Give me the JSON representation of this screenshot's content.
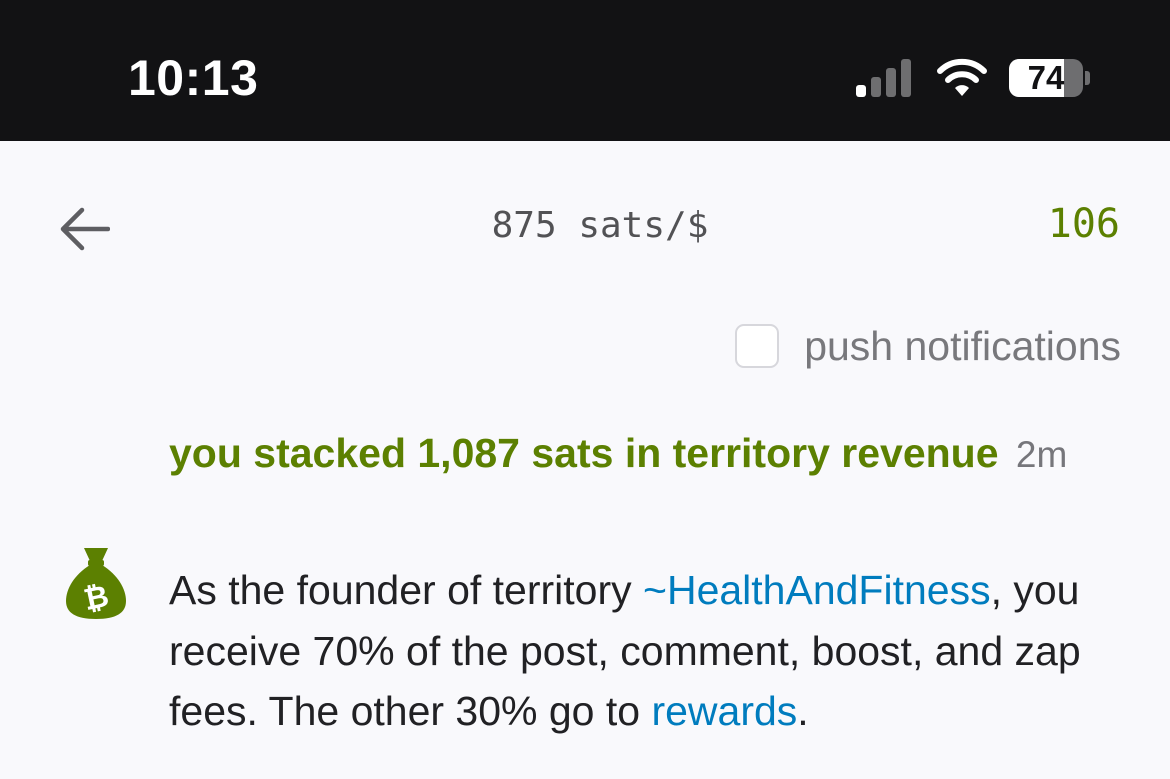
{
  "status_bar": {
    "time": "10:13",
    "battery_level": "74",
    "battery_fraction": 0.74
  },
  "header": {
    "back_icon": "back-arrow-icon",
    "price_ticker": "875 sats/$",
    "wallet_balance": "106"
  },
  "settings": {
    "push_label": "push notifications",
    "push_checked": false
  },
  "notification": {
    "icon": "money-bag-bitcoin-icon",
    "title": "you stacked 1,087 sats in territory revenue",
    "time_ago": "2m",
    "body": {
      "part1": "As the founder of territory ",
      "territory_link": "~HealthAndFitness",
      "part2": ", you receive 70% of the post, comment, boost, and zap fees. The other 30% go to ",
      "rewards_link": "rewards",
      "part3": "."
    }
  },
  "colors": {
    "status_bar_bg": "#121214",
    "page_bg": "#f9f9fc",
    "accent_green": "#5c8001",
    "link_blue": "#007cbe",
    "text_dark": "#212124",
    "text_muted": "#76767b"
  }
}
